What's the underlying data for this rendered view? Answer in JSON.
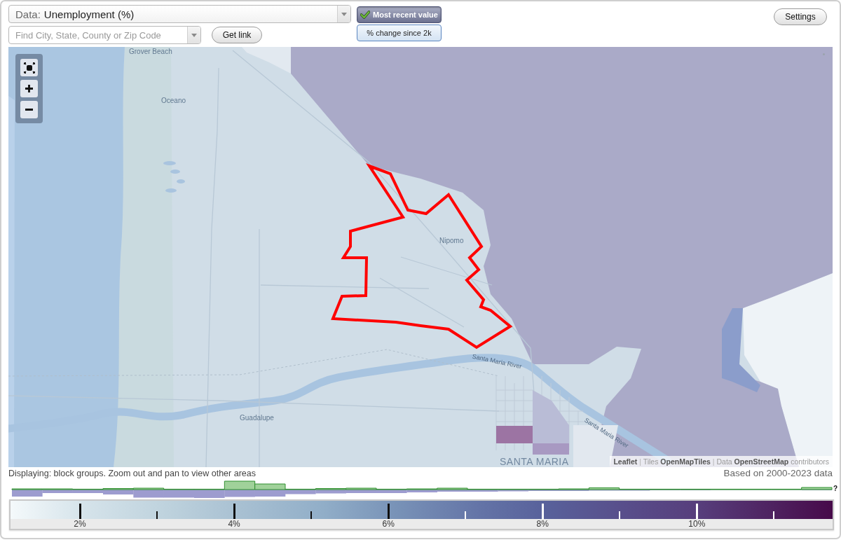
{
  "data_select": {
    "label": "Data:",
    "value": "Unemployment (%)"
  },
  "search": {
    "placeholder": "Find City, State, County or Zip Code"
  },
  "get_link_button": "Get link",
  "view_modes": [
    {
      "label": "Most recent value",
      "selected": true
    },
    {
      "label": "% change since 2k",
      "selected": false
    }
  ],
  "settings_button": "Settings",
  "map": {
    "labels": [
      {
        "text": "Grover Beach",
        "kind": "place"
      },
      {
        "text": "Oceano",
        "kind": "place"
      },
      {
        "text": "Nipomo",
        "kind": "place"
      },
      {
        "text": "Santa Maria River",
        "kind": "river"
      },
      {
        "text": "Guadalupe",
        "kind": "place"
      },
      {
        "text": "Santa Maria River",
        "kind": "river"
      },
      {
        "text": "SANTA MARIA",
        "kind": "city"
      }
    ],
    "attribution": [
      {
        "kind": "link",
        "text": "Leaflet"
      },
      {
        "kind": "separator",
        "text": "|"
      },
      {
        "kind": "plain",
        "text": "Tiles"
      },
      {
        "kind": "link",
        "text": "OpenMapTiles"
      },
      {
        "kind": "separator",
        "text": "|"
      },
      {
        "kind": "plain",
        "text": "Data"
      },
      {
        "kind": "link",
        "text": "OpenStreetMap"
      },
      {
        "kind": "plain",
        "text": "contributors"
      }
    ]
  },
  "status": {
    "displaying": "Displaying: block groups. Zoom out and pan to view other areas",
    "based_on": "Based on 2000-2023 data"
  },
  "histogram": {
    "unknown_label": "?"
  },
  "legend": {
    "tick_labels": [
      "2%",
      "4%",
      "6%",
      "8%",
      "10%"
    ]
  }
}
